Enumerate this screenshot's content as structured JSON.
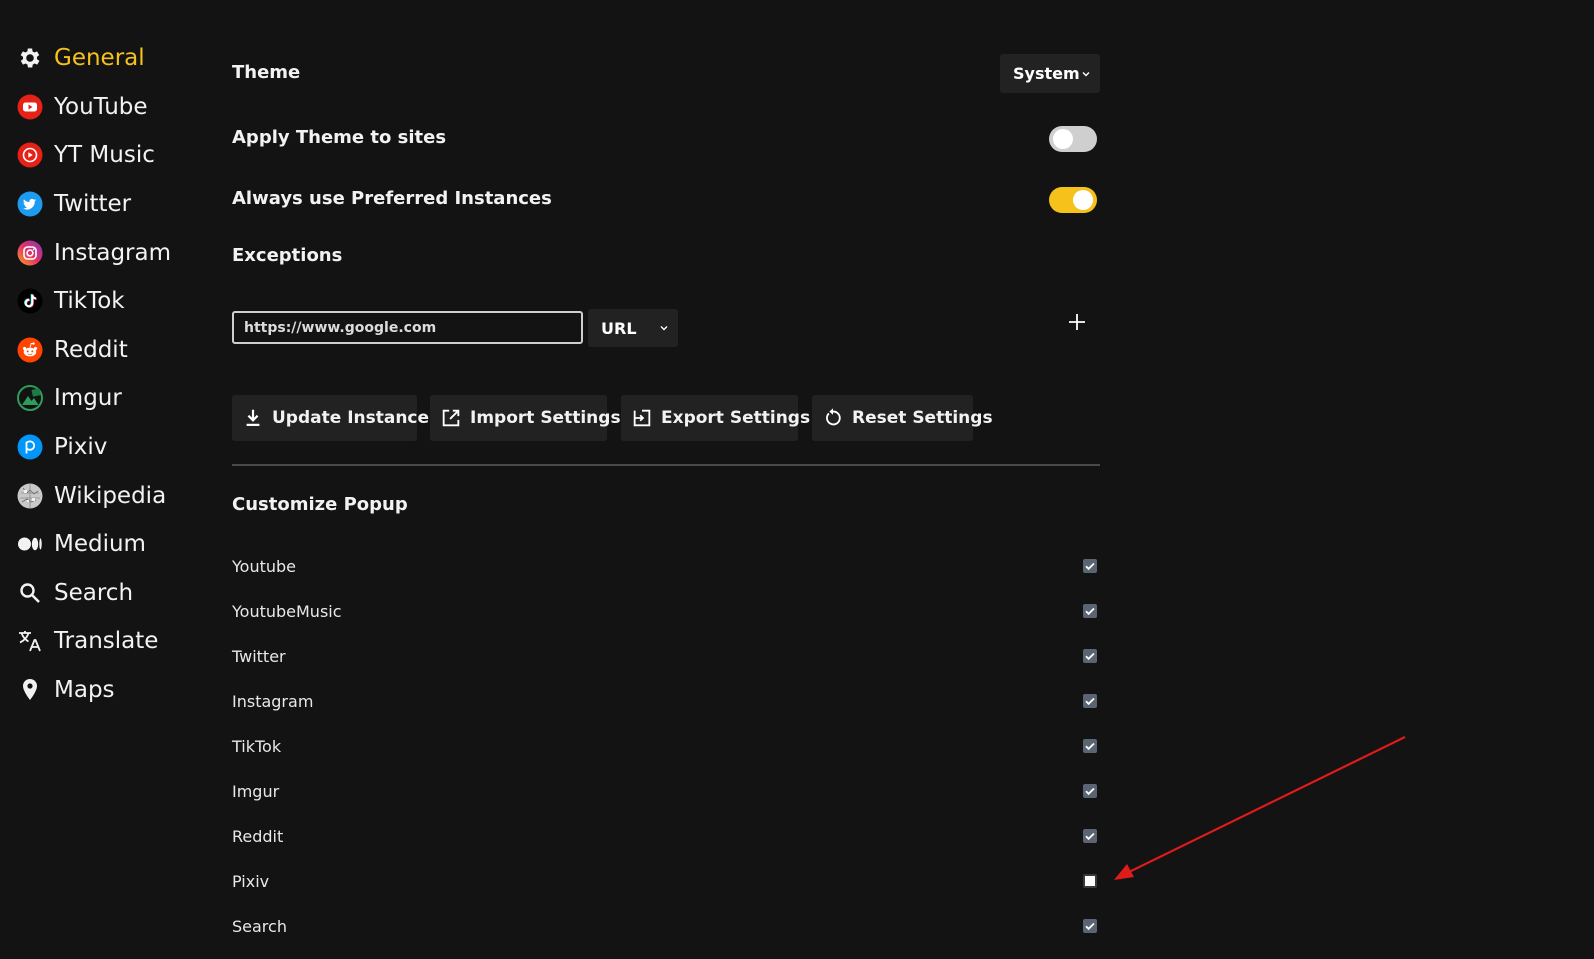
{
  "sidebar": {
    "items": [
      {
        "label": "General",
        "icon": "gear-icon",
        "active": true
      },
      {
        "label": "YouTube",
        "icon": "youtube-icon"
      },
      {
        "label": "YT Music",
        "icon": "yt-music-icon"
      },
      {
        "label": "Twitter",
        "icon": "twitter-icon"
      },
      {
        "label": "Instagram",
        "icon": "instagram-icon"
      },
      {
        "label": "TikTok",
        "icon": "tiktok-icon"
      },
      {
        "label": "Reddit",
        "icon": "reddit-icon"
      },
      {
        "label": "Imgur",
        "icon": "imgur-icon"
      },
      {
        "label": "Pixiv",
        "icon": "pixiv-icon"
      },
      {
        "label": "Wikipedia",
        "icon": "wikipedia-icon"
      },
      {
        "label": "Medium",
        "icon": "medium-icon"
      },
      {
        "label": "Search",
        "icon": "search-icon"
      },
      {
        "label": "Translate",
        "icon": "translate-icon"
      },
      {
        "label": "Maps",
        "icon": "map-pin-icon"
      }
    ]
  },
  "settings": {
    "theme_label": "Theme",
    "theme_value": "System",
    "apply_theme_label": "Apply Theme to sites",
    "apply_theme_on": false,
    "preferred_label": "Always use Preferred Instances",
    "preferred_on": true,
    "exceptions_label": "Exceptions",
    "exception_input_value": "https://www.google.com",
    "exception_type": "URL"
  },
  "actions": {
    "update": "Update Instances",
    "import": "Import Settings",
    "export": "Export Settings",
    "reset": "Reset Settings"
  },
  "popup": {
    "title": "Customize Popup",
    "items": [
      {
        "label": "Youtube",
        "checked": true
      },
      {
        "label": "YoutubeMusic",
        "checked": true
      },
      {
        "label": "Twitter",
        "checked": true
      },
      {
        "label": "Instagram",
        "checked": true
      },
      {
        "label": "TikTok",
        "checked": true
      },
      {
        "label": "Imgur",
        "checked": true
      },
      {
        "label": "Reddit",
        "checked": true
      },
      {
        "label": "Pixiv",
        "checked": false
      },
      {
        "label": "Search",
        "checked": true
      }
    ]
  },
  "colors": {
    "accent": "#f7c11c",
    "background": "#131313",
    "panel": "#222222",
    "annotation_arrow": "#e01b1b"
  }
}
